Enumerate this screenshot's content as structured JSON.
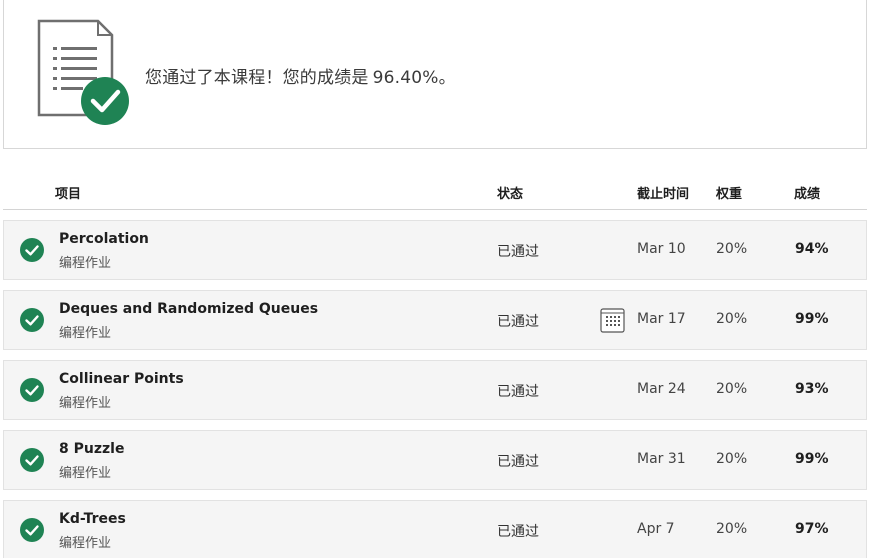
{
  "banner": {
    "message": "您通过了本课程！您的成绩是",
    "grade": "96.40%。"
  },
  "table": {
    "headers": {
      "item": "项目",
      "status": "状态",
      "due": "截止时间",
      "weight": "权重",
      "grade": "成绩"
    },
    "rows": [
      {
        "title": "Percolation",
        "type": "编程作业",
        "status": "已通过",
        "due": "Mar 10",
        "weight": "20%",
        "grade": "94%"
      },
      {
        "title": "Deques and Randomized Queues",
        "type": "编程作业",
        "status": "已通过",
        "due": "Mar 17",
        "weight": "20%",
        "grade": "99%"
      },
      {
        "title": "Collinear Points",
        "type": "编程作业",
        "status": "已通过",
        "due": "Mar 24",
        "weight": "20%",
        "grade": "93%"
      },
      {
        "title": "8 Puzzle",
        "type": "编程作业",
        "status": "已通过",
        "due": "Mar 31",
        "weight": "20%",
        "grade": "99%"
      },
      {
        "title": "Kd-Trees",
        "type": "编程作业",
        "status": "已通过",
        "due": "Apr 7",
        "weight": "20%",
        "grade": "97%"
      }
    ]
  },
  "icons": {
    "banner": "document-checked-icon",
    "row_status": "check-circle-icon",
    "deadline": "calendar-icon"
  },
  "colors": {
    "success_green": "#1f8354",
    "row_background": "#f5f5f5"
  }
}
